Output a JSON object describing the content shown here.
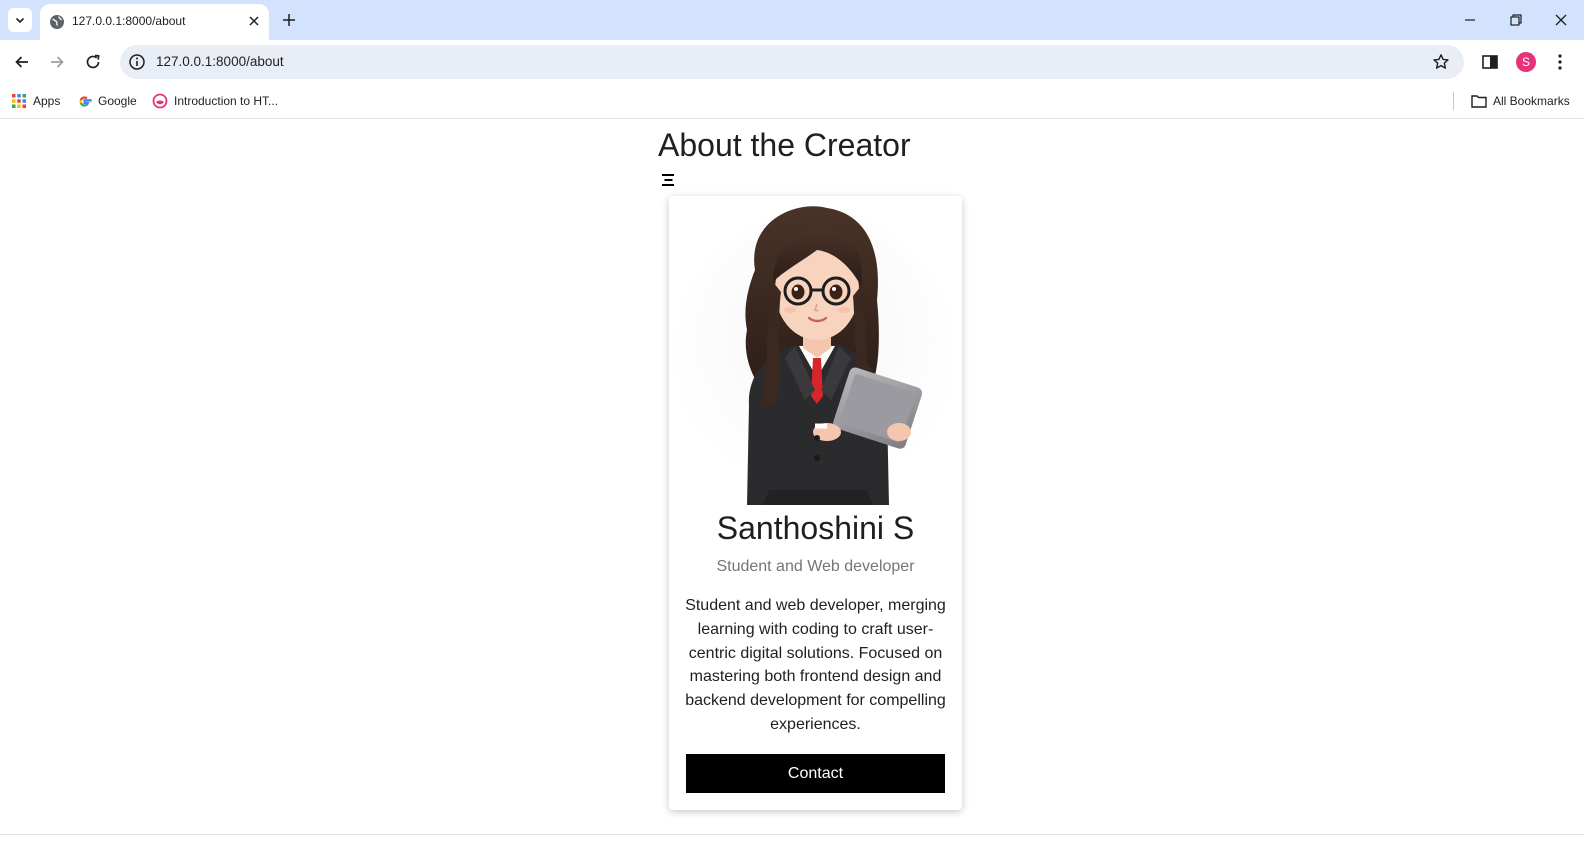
{
  "browser": {
    "tab": {
      "title": "127.0.0.1:8000/about",
      "icons": {
        "favicon": "globe-icon",
        "close": "close-icon"
      }
    },
    "url": "127.0.0.1:8000/about",
    "profile_initial": "S",
    "bookmarks": [
      {
        "label": "Apps",
        "icon": "apps-grid-icon"
      },
      {
        "label": "Google",
        "icon": "google-icon"
      },
      {
        "label": "Introduction to HT...",
        "icon": "favicon-icon"
      }
    ],
    "all_bookmarks_label": "All Bookmarks",
    "colors": {
      "tabstrip": "#d3e3fd",
      "omnibox": "#e9eef6",
      "avatar": "#e8317a"
    }
  },
  "page": {
    "title": "About the Creator",
    "menu_icon": "hamburger-icon",
    "card": {
      "name": "Santhoshini S",
      "role": "Student and Web developer",
      "bio": "Student and web developer, merging learning with coding to craft user-centric digital solutions. Focused on mastering both frontend design and backend development for compelling experiences.",
      "contact_label": "Contact",
      "portrait": "cartoon-woman-with-tablet-illustration"
    }
  }
}
